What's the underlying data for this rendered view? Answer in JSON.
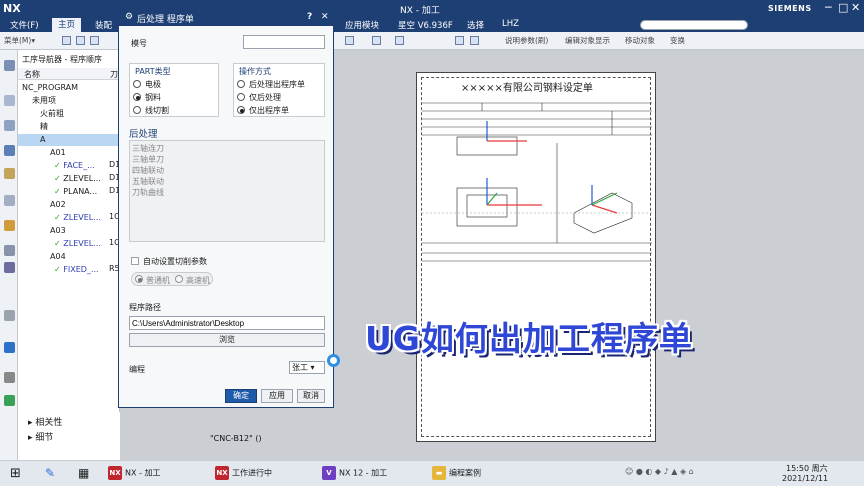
{
  "window": {
    "app": "NX",
    "title": "NX - 加工",
    "brand": "SIEMENS",
    "min": "─",
    "max": "□",
    "close": "✕"
  },
  "menubar": {
    "items": [
      "文件(F)",
      "主页",
      "装配",
      "应用模块",
      "星空 V6.936F",
      "选择",
      "LHZ"
    ],
    "search_placeholder": ""
  },
  "toolbar": {
    "menu": "菜单(M)▾",
    "items": [
      "说明参数(刷)",
      "编辑对象显示",
      "移动对象",
      "变换"
    ]
  },
  "navigator": {
    "title": "工序导航器 - 程序顺序",
    "column_name": "名称",
    "column_tool": "刀",
    "rows": [
      {
        "label": "NC_PROGRAM"
      },
      {
        "label": "未用项"
      },
      {
        "label": "火前粗"
      },
      {
        "label": "精"
      },
      {
        "label": "A"
      },
      {
        "label": "A01"
      },
      {
        "label": "FACE_..."
      },
      {
        "label": "ZLEVEL..."
      },
      {
        "label": "PLANA..."
      },
      {
        "label": "A02"
      },
      {
        "label": "ZLEVEL..."
      },
      {
        "label": "A03"
      },
      {
        "label": "ZLEVEL..."
      },
      {
        "label": "A04"
      },
      {
        "label": "FIXED_..."
      }
    ],
    "tool_vals": [
      "D1",
      "D1",
      "D1",
      "1C",
      "1C",
      "R5"
    ],
    "bottom": [
      "相关性",
      "细节"
    ]
  },
  "dialog": {
    "title": "后处理 程序单",
    "help": "?",
    "close": "✕",
    "mold_no_label": "模号",
    "mold_no_value": "",
    "part_type_label": "PART类型",
    "part_types": [
      "电极",
      "钢料",
      "线切割"
    ],
    "part_selected": 1,
    "op_mode_label": "操作方式",
    "op_modes": [
      "后处理出程序单",
      "仅后处理",
      "仅出程序单"
    ],
    "op_selected": 2,
    "post_label": "后处理",
    "post_items": [
      "三轴连刀",
      "三轴单刀",
      "四轴联动",
      "五轴联动",
      "刀轨曲线"
    ],
    "auto_label": "自动设置切削参数",
    "speed_opts": [
      "普通机",
      "高速机"
    ],
    "path_label": "程序路径",
    "path_value": "C:\\Users\\Administrator\\Desktop",
    "browse": "浏览",
    "programmer_label": "编程",
    "programmer_value": "张工",
    "ok": "确定",
    "apply": "应用",
    "cancel": "取消"
  },
  "drawing": {
    "title": "×××××有限公司钢料设定单",
    "status": "\"CNC-B12\"  ()"
  },
  "overlay_text": "UG如何出加工程序单",
  "taskbar": {
    "tasks": [
      "NX - 加工",
      "工作进行中",
      "NX 12 - 加工",
      "编程案例"
    ],
    "time": "15:50 周六",
    "date": "2021/12/11"
  }
}
